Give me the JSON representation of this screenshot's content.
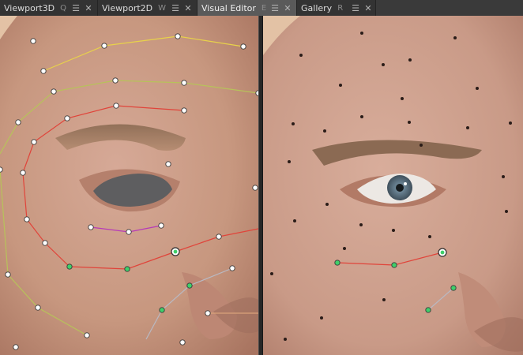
{
  "tabs": [
    {
      "label": "Viewport3D",
      "shortcut": "Q",
      "active": false
    },
    {
      "label": "Viewport2D",
      "shortcut": "W",
      "active": false
    },
    {
      "label": "Visual Editor",
      "shortcut": "E",
      "active": true
    },
    {
      "label": "Gallery",
      "shortcut": "R",
      "active": false
    }
  ],
  "icons": {
    "menu": "hamburger-menu-icon",
    "close": "close-icon"
  },
  "glyphs": {
    "menu": "☰",
    "close": "✕"
  },
  "colors": {
    "skin": "#c99a87",
    "curve_yellow": "#e8d24a",
    "curve_olive": "#b7c25a",
    "curve_red": "#e0443a",
    "curve_magenta": "#b63ab8",
    "curve_grey": "#b9b9c3",
    "point_white": "#ffffff",
    "point_green": "#3fcf6a",
    "gallery_marker": "#2a1c18"
  }
}
